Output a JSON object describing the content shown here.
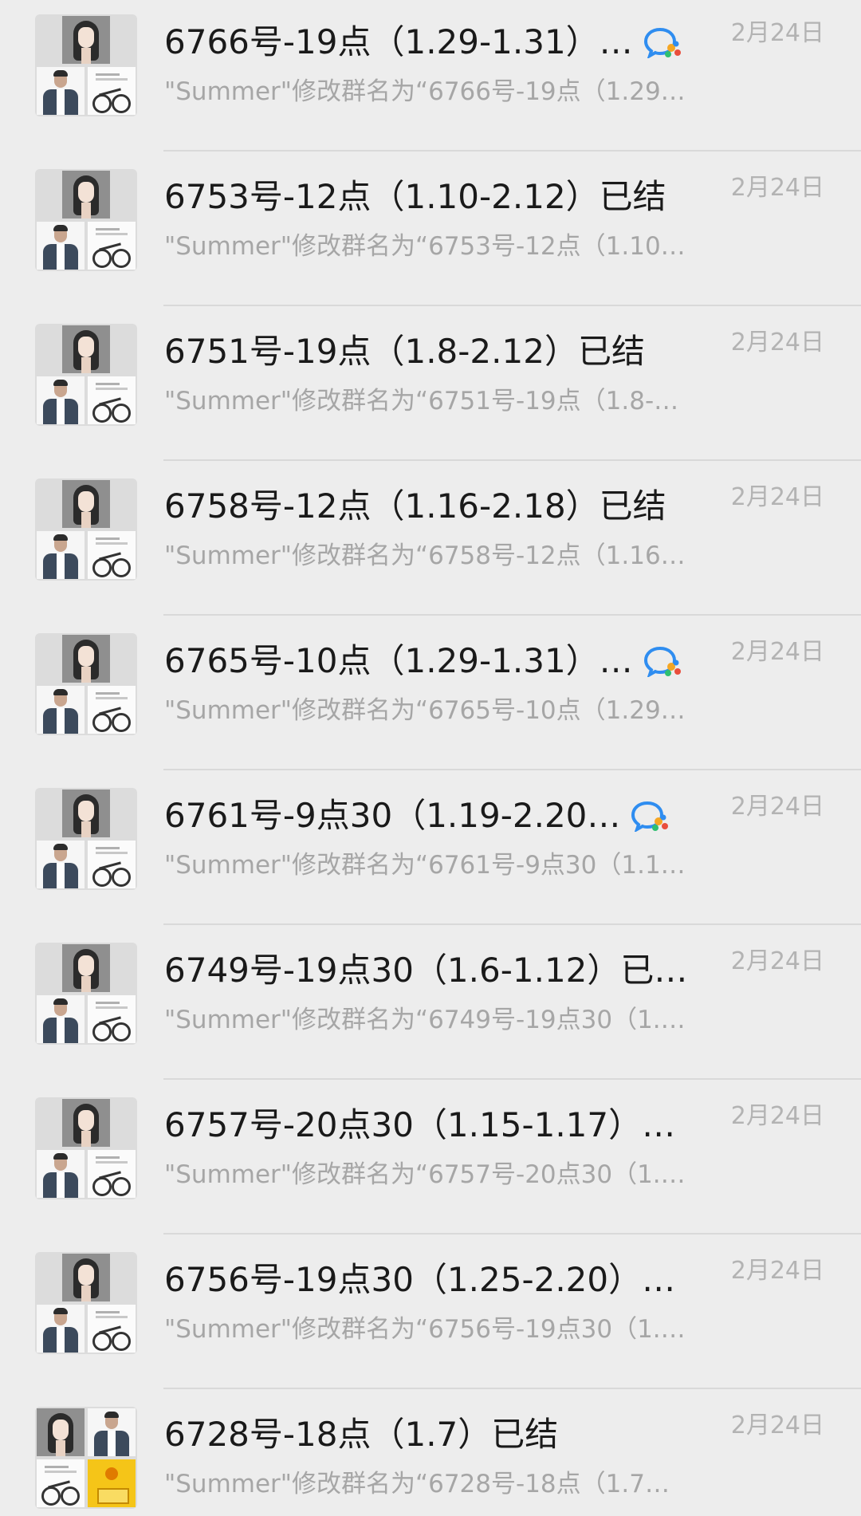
{
  "chats": [
    {
      "title": "6766号-19点（1.29-1.31）…",
      "preview": "\"Summer\"修改群名为“6766号-19点（1.29…",
      "date": "2月24日",
      "wecom_badge": true,
      "avatar": "3"
    },
    {
      "title": "6753号-12点（1.10-2.12）已结",
      "preview": "\"Summer\"修改群名为“6753号-12点（1.10…",
      "date": "2月24日",
      "wecom_badge": false,
      "avatar": "3"
    },
    {
      "title": "6751号-19点（1.8-2.12）已结",
      "preview": "\"Summer\"修改群名为“6751号-19点（1.8-…",
      "date": "2月24日",
      "wecom_badge": false,
      "avatar": "3"
    },
    {
      "title": "6758号-12点（1.16-2.18）已结",
      "preview": "\"Summer\"修改群名为“6758号-12点（1.16…",
      "date": "2月24日",
      "wecom_badge": false,
      "avatar": "3"
    },
    {
      "title": "6765号-10点（1.29-1.31）…",
      "preview": "\"Summer\"修改群名为“6765号-10点（1.29…",
      "date": "2月24日",
      "wecom_badge": true,
      "avatar": "3"
    },
    {
      "title": "6761号-9点30（1.19-2.20…",
      "preview": "\"Summer\"修改群名为“6761号-9点30（1.1…",
      "date": "2月24日",
      "wecom_badge": true,
      "avatar": "3"
    },
    {
      "title": "6749号-19点30（1.6-1.12）已…",
      "preview": "\"Summer\"修改群名为“6749号-19点30（1.…",
      "date": "2月24日",
      "wecom_badge": false,
      "avatar": "3"
    },
    {
      "title": "6757号-20点30（1.15-1.17）…",
      "preview": "\"Summer\"修改群名为“6757号-20点30（1.…",
      "date": "2月24日",
      "wecom_badge": false,
      "avatar": "3"
    },
    {
      "title": "6756号-19点30（1.25-2.20）…",
      "preview": "\"Summer\"修改群名为“6756号-19点30（1.…",
      "date": "2月24日",
      "wecom_badge": false,
      "avatar": "3"
    },
    {
      "title": "6728号-18点（1.7）已结",
      "preview": "\"Summer\"修改群名为“6728号-18点（1.7…",
      "date": "2月24日",
      "wecom_badge": false,
      "avatar": "4"
    }
  ]
}
